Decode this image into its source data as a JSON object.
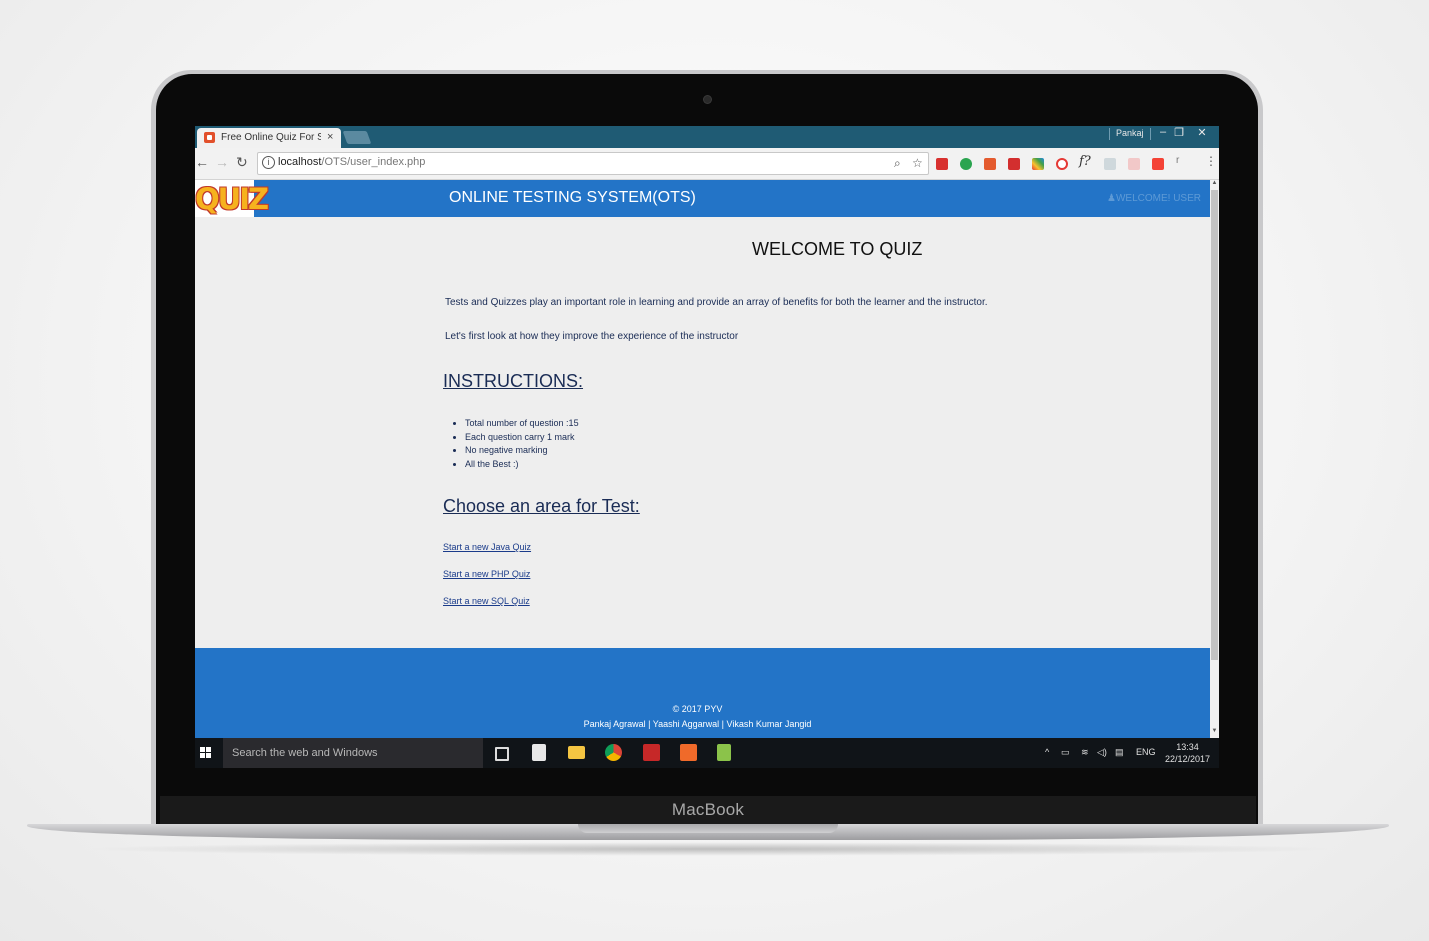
{
  "device": {
    "label": "MacBook"
  },
  "browser": {
    "tab_title": "Free Online Quiz For Stu",
    "tab_close": "×",
    "window_user": "Pankaj",
    "window_controls": {
      "minimize": "–",
      "restore": "❐",
      "close": "✕"
    },
    "url_host": "localhost",
    "url_path": "/OTS/user_index.php"
  },
  "header": {
    "logo_text": "QUIZ",
    "site_title": "ONLINE TESTING SYSTEM(OTS)",
    "welcome_user": "WELCOME! USER"
  },
  "main": {
    "title": "WELCOME TO QUIZ",
    "intro_1": "Tests and Quizzes play an important role in learning and provide an array of benefits for both the learner and the instructor.",
    "intro_2": "Let's first look at how they improve the experience of the instructor",
    "instructions_heading": "INSTRUCTIONS:",
    "instructions": [
      "Total number of question :15",
      "Each question carry 1 mark",
      "No negative marking",
      "All the Best :)"
    ],
    "choose_heading": "Choose an area for Test:",
    "quiz_links": [
      "Start a new Java Quiz",
      "Start a new PHP Quiz",
      "Start a new SQL Quiz"
    ]
  },
  "footer": {
    "copyright": "© 2017 PYV",
    "authors": "Pankaj Agrawal | Yaashi Aggarwal | Vikash Kumar Jangid"
  },
  "taskbar": {
    "search_placeholder": "Search the web and Windows",
    "language": "ENG",
    "time": "13:34",
    "date": "22/12/2017"
  },
  "colors": {
    "accent_blue": "#2374c7",
    "titlebar": "#1f5b74",
    "logo_yellow": "#f6b21e"
  }
}
